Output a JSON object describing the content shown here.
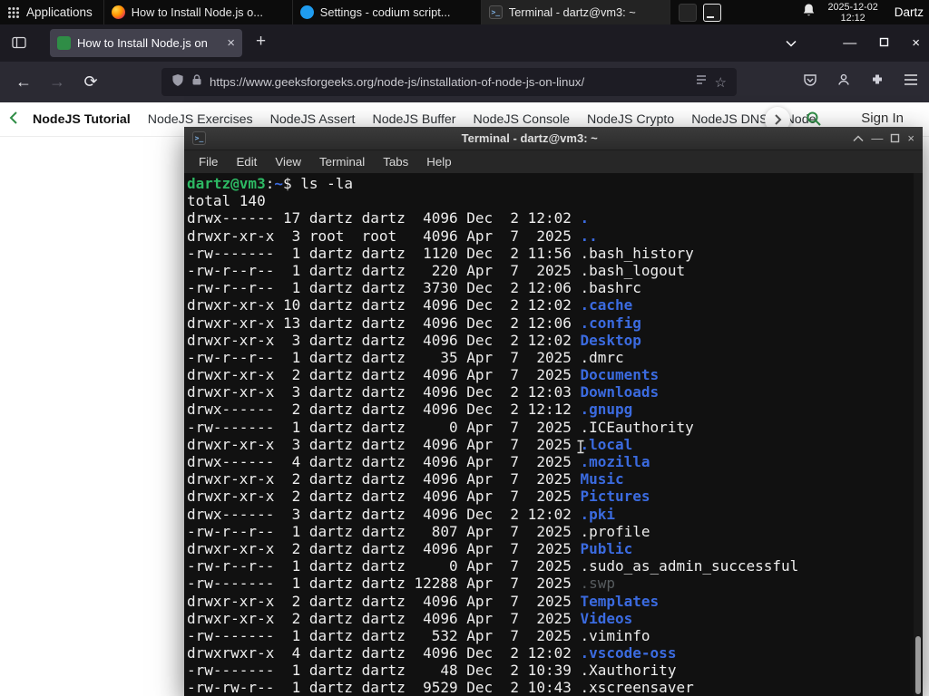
{
  "theme": {
    "term-bg": "#111111",
    "term-fg": "#ededed",
    "term-green": "#2db863",
    "term-blue": "#3b6be0",
    "term-muted": "#585d60",
    "gfg-green": "#2f8d46"
  },
  "icons": {
    "close": "×",
    "new_tab": "+",
    "back": "←",
    "forward": "→",
    "reload": "⟳",
    "star": "☆",
    "minimize": "—",
    "terminal_glyph": ">_"
  },
  "panel": {
    "applications_label": "Applications",
    "window_buttons": [
      {
        "title": "How to Install Node.js o..."
      },
      {
        "title": "Settings - codium script..."
      },
      {
        "title": "Terminal - dartz@vm3: ~"
      }
    ],
    "clock": {
      "date": "2025-12-02",
      "time": "12:12"
    },
    "user_label": "Dartz"
  },
  "browser": {
    "tab": {
      "title": "How to Install Node.js on"
    },
    "urlbar": {
      "url": "https://www.geeksforgeeks.org/node-js/installation-of-node-js-on-linux/"
    },
    "site_nav": {
      "items": [
        "NodeJS Tutorial",
        "NodeJS Exercises",
        "NodeJS Assert",
        "NodeJS Buffer",
        "NodeJS Console",
        "NodeJS Crypto",
        "NodeJS DNS",
        "Node"
      ],
      "sign_in_label": "Sign In"
    }
  },
  "terminal": {
    "window_title": "Terminal - dartz@vm3: ~",
    "menu_items": [
      "File",
      "Edit",
      "View",
      "Terminal",
      "Tabs",
      "Help"
    ],
    "prompt": {
      "user_host": "dartz@vm3",
      "separator": ":",
      "path": "~",
      "symbol": "$"
    },
    "command": "ls -la",
    "total_line": "total 140",
    "listing": [
      [
        "drwx------",
        17,
        "dartz",
        "dartz",
        4096,
        "Dec",
        2,
        "12:02",
        ".",
        "dir"
      ],
      [
        "drwxr-xr-x",
        3,
        "root",
        "root",
        4096,
        "Apr",
        7,
        "2025",
        "..",
        "dir"
      ],
      [
        "-rw-------",
        1,
        "dartz",
        "dartz",
        1120,
        "Dec",
        2,
        "11:56",
        ".bash_history",
        "file"
      ],
      [
        "-rw-r--r--",
        1,
        "dartz",
        "dartz",
        220,
        "Apr",
        7,
        "2025",
        ".bash_logout",
        "file"
      ],
      [
        "-rw-r--r--",
        1,
        "dartz",
        "dartz",
        3730,
        "Dec",
        2,
        "12:06",
        ".bashrc",
        "file"
      ],
      [
        "drwxr-xr-x",
        10,
        "dartz",
        "dartz",
        4096,
        "Dec",
        2,
        "12:02",
        ".cache",
        "dir"
      ],
      [
        "drwxr-xr-x",
        13,
        "dartz",
        "dartz",
        4096,
        "Dec",
        2,
        "12:06",
        ".config",
        "dir"
      ],
      [
        "drwxr-xr-x",
        3,
        "dartz",
        "dartz",
        4096,
        "Dec",
        2,
        "12:02",
        "Desktop",
        "dir"
      ],
      [
        "-rw-r--r--",
        1,
        "dartz",
        "dartz",
        35,
        "Apr",
        7,
        "2025",
        ".dmrc",
        "file"
      ],
      [
        "drwxr-xr-x",
        2,
        "dartz",
        "dartz",
        4096,
        "Apr",
        7,
        "2025",
        "Documents",
        "dir"
      ],
      [
        "drwxr-xr-x",
        3,
        "dartz",
        "dartz",
        4096,
        "Dec",
        2,
        "12:03",
        "Downloads",
        "dir"
      ],
      [
        "drwx------",
        2,
        "dartz",
        "dartz",
        4096,
        "Dec",
        2,
        "12:12",
        ".gnupg",
        "dir"
      ],
      [
        "-rw-------",
        1,
        "dartz",
        "dartz",
        0,
        "Apr",
        7,
        "2025",
        ".ICEauthority",
        "file"
      ],
      [
        "drwxr-xr-x",
        3,
        "dartz",
        "dartz",
        4096,
        "Apr",
        7,
        "2025",
        ".local",
        "dir"
      ],
      [
        "drwx------",
        4,
        "dartz",
        "dartz",
        4096,
        "Apr",
        7,
        "2025",
        ".mozilla",
        "dir"
      ],
      [
        "drwxr-xr-x",
        2,
        "dartz",
        "dartz",
        4096,
        "Apr",
        7,
        "2025",
        "Music",
        "dir"
      ],
      [
        "drwxr-xr-x",
        2,
        "dartz",
        "dartz",
        4096,
        "Apr",
        7,
        "2025",
        "Pictures",
        "dir"
      ],
      [
        "drwx------",
        3,
        "dartz",
        "dartz",
        4096,
        "Dec",
        2,
        "12:02",
        ".pki",
        "dir"
      ],
      [
        "-rw-r--r--",
        1,
        "dartz",
        "dartz",
        807,
        "Apr",
        7,
        "2025",
        ".profile",
        "file"
      ],
      [
        "drwxr-xr-x",
        2,
        "dartz",
        "dartz",
        4096,
        "Apr",
        7,
        "2025",
        "Public",
        "dir"
      ],
      [
        "-rw-r--r--",
        1,
        "dartz",
        "dartz",
        0,
        "Apr",
        7,
        "2025",
        ".sudo_as_admin_successful",
        "file"
      ],
      [
        "-rw-------",
        1,
        "dartz",
        "dartz",
        12288,
        "Apr",
        7,
        "2025",
        ".swp",
        "muted"
      ],
      [
        "drwxr-xr-x",
        2,
        "dartz",
        "dartz",
        4096,
        "Apr",
        7,
        "2025",
        "Templates",
        "dir"
      ],
      [
        "drwxr-xr-x",
        2,
        "dartz",
        "dartz",
        4096,
        "Apr",
        7,
        "2025",
        "Videos",
        "dir"
      ],
      [
        "-rw-------",
        1,
        "dartz",
        "dartz",
        532,
        "Apr",
        7,
        "2025",
        ".viminfo",
        "file"
      ],
      [
        "drwxrwxr-x",
        4,
        "dartz",
        "dartz",
        4096,
        "Dec",
        2,
        "12:02",
        ".vscode-oss",
        "dir"
      ],
      [
        "-rw-------",
        1,
        "dartz",
        "dartz",
        48,
        "Dec",
        2,
        "10:39",
        ".Xauthority",
        "file"
      ],
      [
        "-rw-rw-r--",
        1,
        "dartz",
        "dartz",
        9529,
        "Dec",
        2,
        "10:43",
        ".xscreensaver",
        "file"
      ]
    ]
  }
}
